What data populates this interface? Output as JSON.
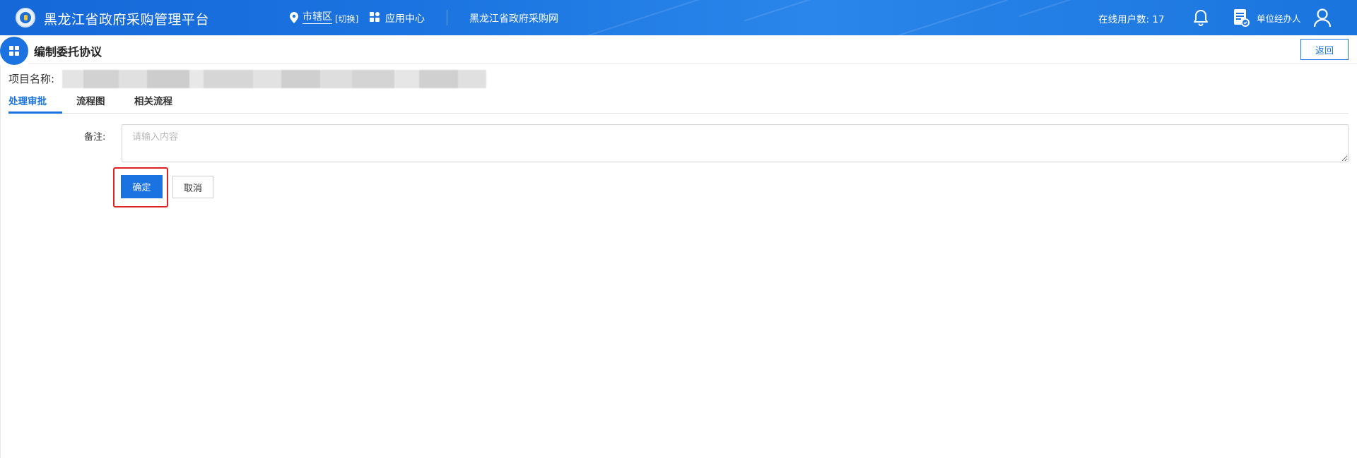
{
  "header": {
    "app_title": "黑龙江省政府采购管理平台",
    "location": "市辖区",
    "location_switch": "[切换]",
    "app_center": "应用中心",
    "portal_link": "黑龙江省政府采购网",
    "online_users_label": "在线用户数:",
    "online_users_count": "17",
    "role": "单位经办人"
  },
  "page": {
    "title": "编制委托协议",
    "back_label": "返回",
    "project_name_label": "项目名称:"
  },
  "tabs": [
    {
      "label": "处理审批",
      "active": true
    },
    {
      "label": "流程图",
      "active": false
    },
    {
      "label": "相关流程",
      "active": false
    }
  ],
  "form": {
    "remark_label": "备注:",
    "remark_placeholder": "请输入内容",
    "remark_value": "",
    "confirm_label": "确定",
    "cancel_label": "取消"
  },
  "icons": {
    "logo": "emblem-logo",
    "location": "map-pin-icon",
    "apps": "grid-apps-icon",
    "notifications": "bell-icon",
    "document": "document-icon",
    "user": "user-icon",
    "page_badge": "grid-apps-icon"
  },
  "colors": {
    "primary": "#1a73e0",
    "highlight": "#e02020",
    "header_bg": "#1a73e0"
  }
}
